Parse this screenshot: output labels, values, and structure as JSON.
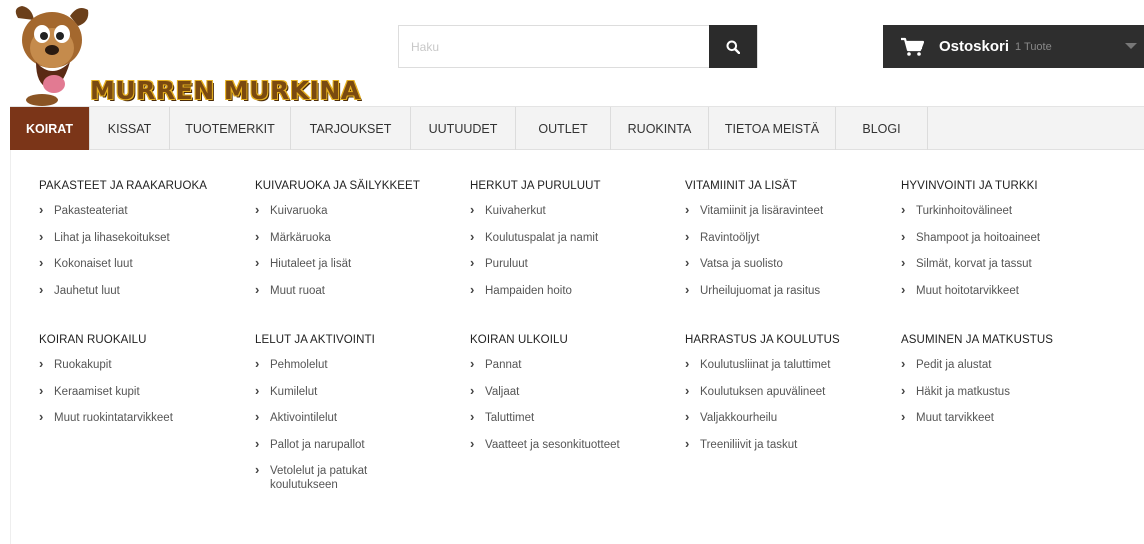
{
  "logo": {
    "title": "MURREN MURKINA",
    "icon": "dog-mascot-icon"
  },
  "search": {
    "placeholder": "Haku",
    "value": "",
    "button_icon": "search-icon"
  },
  "cart": {
    "label": "Ostoskori",
    "count": "1 Tuote",
    "icon": "cart-icon",
    "caret_icon": "chevron-down-icon"
  },
  "colors": {
    "accent": "#7b3518",
    "dark": "#2e2e2e"
  },
  "nav": {
    "items": [
      {
        "label": "KOIRAT",
        "active": true
      },
      {
        "label": "KISSAT"
      },
      {
        "label": "TUOTEMERKIT"
      },
      {
        "label": "TARJOUKSET"
      },
      {
        "label": "UUTUUDET"
      },
      {
        "label": "OUTLET"
      },
      {
        "label": "RUOKINTA"
      },
      {
        "label": "TIETOA MEISTÄ"
      },
      {
        "label": "BLOGI"
      }
    ]
  },
  "menu": {
    "groups": [
      {
        "title": "PAKASTEET JA RAAKARUOKA",
        "items": [
          "Pakasteateriat",
          "Lihat ja lihasekoitukset",
          "Kokonaiset luut",
          "Jauhetut luut"
        ]
      },
      {
        "title": "KUIVARUOKA JA SÄILYKKEET",
        "items": [
          "Kuivaruoka",
          "Märkäruoka",
          "Hiutaleet ja lisät",
          "Muut ruoat"
        ]
      },
      {
        "title": "HERKUT JA PURULUUT",
        "items": [
          "Kuivaherkut",
          "Koulutuspalat ja namit",
          "Puruluut",
          "Hampaiden hoito"
        ]
      },
      {
        "title": "VITAMIINIT JA LISÄT",
        "items": [
          "Vitamiinit ja lisäravinteet",
          "Ravintoöljyt",
          "Vatsa ja suolisto",
          "Urheilujuomat ja rasitus"
        ]
      },
      {
        "title": "HYVINVOINTI JA TURKKI",
        "items": [
          "Turkinhoitovälineet",
          "Shampoot ja hoitoaineet",
          "Silmät, korvat ja tassut",
          "Muut hoitotarvikkeet"
        ]
      },
      {
        "title": "KOIRAN RUOKAILU",
        "items": [
          "Ruokakupit",
          "Keraamiset kupit",
          "Muut ruokintatarvikkeet"
        ]
      },
      {
        "title": "LELUT JA AKTIVOINTI",
        "items": [
          "Pehmolelut",
          "Kumilelut",
          "Aktivointilelut",
          "Pallot ja narupallot",
          "Vetolelut ja patukat koulutukseen"
        ]
      },
      {
        "title": "KOIRAN ULKOILU",
        "items": [
          "Pannat",
          "Valjaat",
          "Taluttimet",
          "Vaatteet ja sesonkituotteet"
        ]
      },
      {
        "title": "HARRASTUS JA KOULUTUS",
        "items": [
          "Koulutusliinat ja taluttimet",
          "Koulutuksen apuvälineet",
          "Valjakkourheilu",
          "Treeniliivit ja taskut"
        ]
      },
      {
        "title": "ASUMINEN JA MATKUSTUS",
        "items": [
          "Pedit ja alustat",
          "Häkit ja matkustus",
          "Muut tarvikkeet"
        ]
      }
    ]
  }
}
